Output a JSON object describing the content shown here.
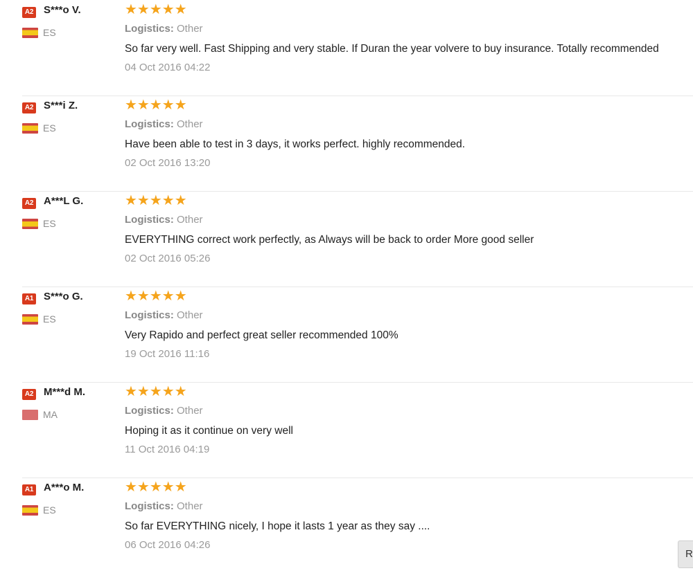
{
  "reviews": [
    {
      "badge": "A2",
      "name": "S***o V.",
      "flag": "es",
      "country": "ES",
      "stars": "★★★★★",
      "logistics_label": "Logistics:",
      "logistics_value": "Other",
      "comment": "So far very well. Fast Shipping and very stable. If Duran the year volvere to buy insurance. Totally recommended",
      "date": "04 Oct 2016 04:22"
    },
    {
      "badge": "A2",
      "name": "S***i Z.",
      "flag": "es",
      "country": "ES",
      "stars": "★★★★★",
      "logistics_label": "Logistics:",
      "logistics_value": "Other",
      "comment": "Have been able to test in 3 days, it works perfect. highly recommended.",
      "date": "02 Oct 2016 13:20"
    },
    {
      "badge": "A2",
      "name": "A***L G.",
      "flag": "es",
      "country": "ES",
      "stars": "★★★★★",
      "logistics_label": "Logistics:",
      "logistics_value": "Other",
      "comment": "EVERYTHING correct work perfectly, as Always will be back to order More good seller",
      "date": "02 Oct 2016 05:26"
    },
    {
      "badge": "A1",
      "name": "S***o G.",
      "flag": "es",
      "country": "ES",
      "stars": "★★★★★",
      "logistics_label": "Logistics:",
      "logistics_value": "Other",
      "comment": "Very Rapido and perfect great seller recommended 100%",
      "date": "19 Oct 2016 11:16"
    },
    {
      "badge": "A2",
      "name": "M***d M.",
      "flag": "ma",
      "country": "MA",
      "stars": "★★★★★",
      "logistics_label": "Logistics:",
      "logistics_value": "Other",
      "comment": "Hoping it as it continue on very well",
      "date": "11 Oct 2016 04:19"
    },
    {
      "badge": "A1",
      "name": "A***o M.",
      "flag": "es",
      "country": "ES",
      "stars": "★★★★★",
      "logistics_label": "Logistics:",
      "logistics_value": "Other",
      "comment": "So far EVERYTHING nicely, I hope it lasts 1 year as they say ....",
      "date": "06 Oct 2016 04:26"
    }
  ],
  "rating": {
    "max": 5,
    "values": [
      5,
      5,
      5,
      5,
      5,
      5
    ]
  },
  "colors": {
    "star": "#f5a41c",
    "badge": "#d83a1d"
  },
  "corner_button": {
    "label": "R"
  }
}
